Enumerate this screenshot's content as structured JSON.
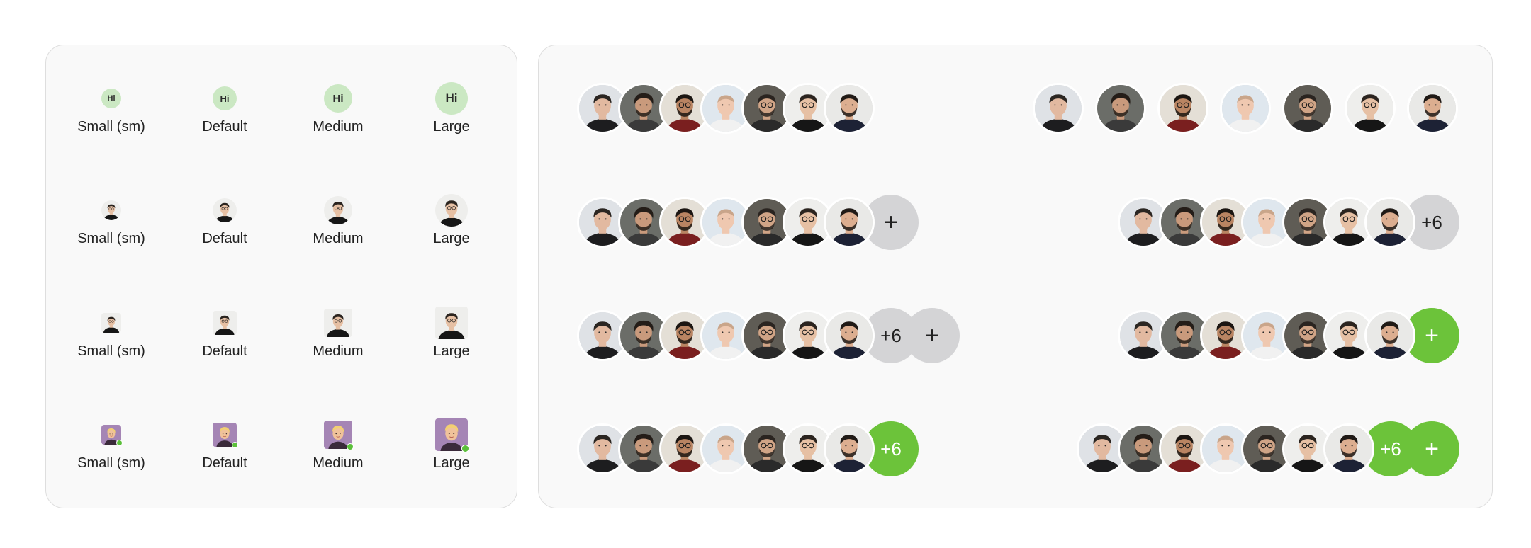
{
  "sizes": {
    "small": "Small (sm)",
    "default": "Default",
    "medium": "Medium",
    "large": "Large"
  },
  "initials": "Hi",
  "more": {
    "count_label": "+6",
    "add_label": "+"
  },
  "colors": {
    "initials_bg": "#cbe8c3",
    "gray_pill": "#d4d4d6",
    "green_pill": "#6cc33a",
    "status_online": "#5bbf3a",
    "avatar_purple_bg": "#a585b5"
  },
  "icons": {
    "add": "plus-icon",
    "online": "status-dot-icon"
  }
}
